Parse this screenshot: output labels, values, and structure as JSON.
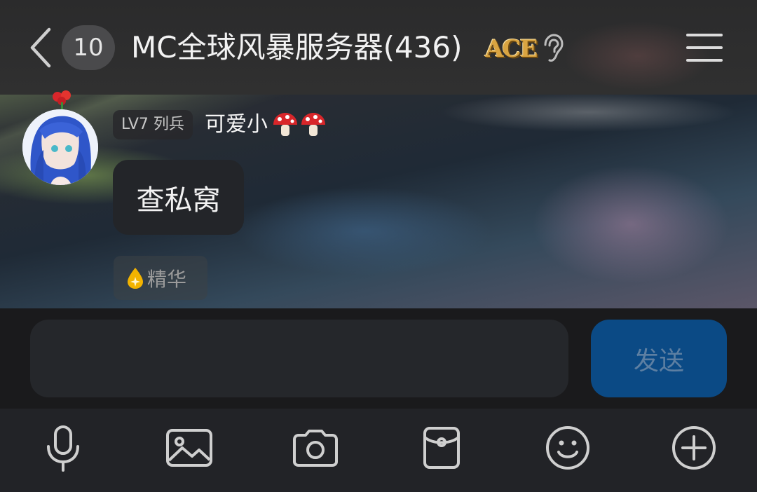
{
  "header": {
    "unread_count": "10",
    "group_title": "MC全球风暴服务器(436)",
    "logo_text": "ACE",
    "icons": [
      "chevron-left-icon",
      "ear-icon",
      "hamburger-menu-icon"
    ]
  },
  "message": {
    "level_badge": "LV7 列兵",
    "sender_name": "可爱小",
    "name_decoration": "mushroom-icon",
    "text": "查私窝",
    "tag_label": "精华",
    "tag_icon": "droplet-sparkle-icon"
  },
  "composer": {
    "input_value": "",
    "send_label": "发送"
  },
  "toolbar": {
    "items": [
      "microphone-icon",
      "image-icon",
      "camera-icon",
      "red-packet-icon",
      "emoji-icon",
      "plus-circle-icon"
    ]
  },
  "colors": {
    "send_button": "#0b4a85",
    "bubble": "#232529",
    "header": "#2e2e2f",
    "toolbar": "#222327",
    "essence_icon": "#f2b300"
  }
}
